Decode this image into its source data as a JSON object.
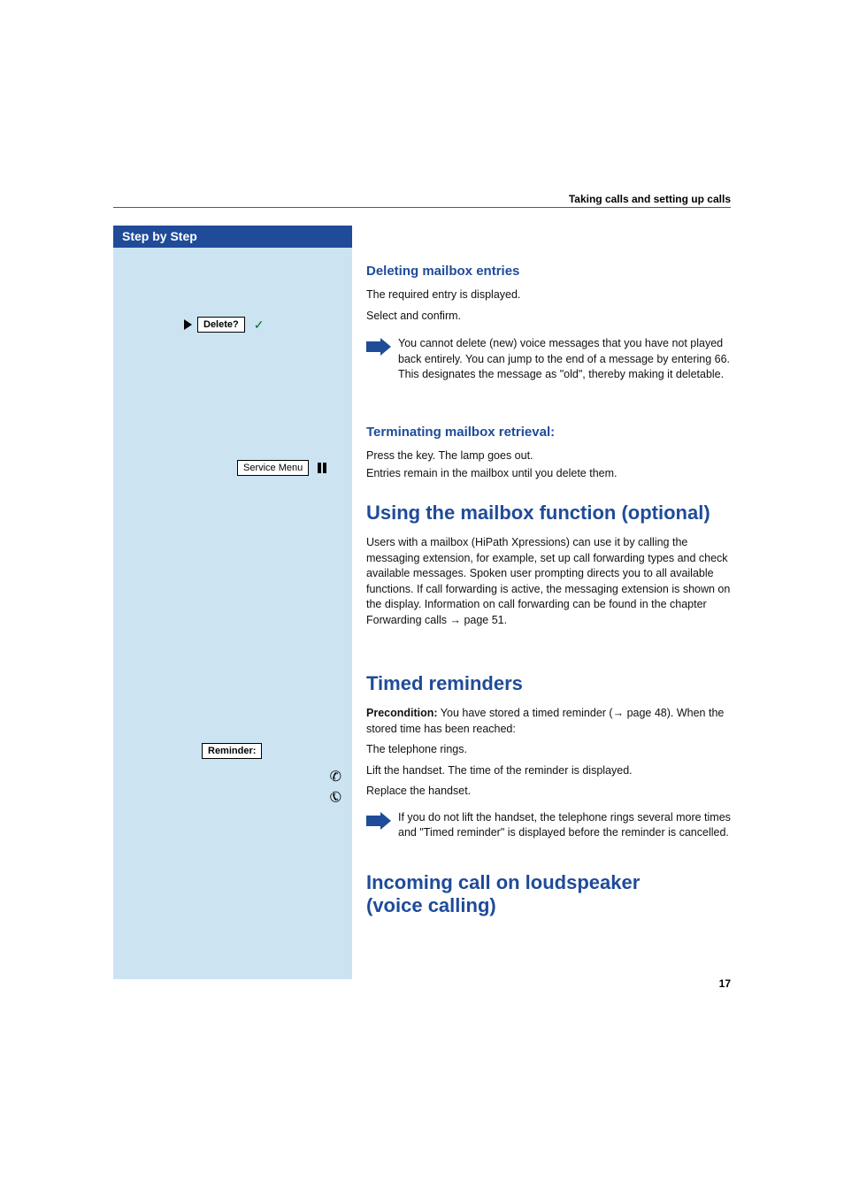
{
  "header": {
    "running_title": "Taking calls and setting up calls"
  },
  "sidebar": {
    "title": "Step by Step",
    "steps": {
      "delete": {
        "label": "Delete?"
      },
      "service_menu": {
        "label": "Service Menu"
      },
      "reminder": {
        "label": "Reminder:"
      }
    }
  },
  "content": {
    "s1": {
      "heading": "Deleting mailbox entries",
      "line1": "The required entry is displayed.",
      "line2": "Select and confirm.",
      "note": "You cannot delete (new) voice messages that you have not played back entirely. You can jump to the end of a message by entering 66. This designates the message as \"old\", thereby making it deletable."
    },
    "s2": {
      "heading": "Terminating mailbox retrieval:",
      "line1": "Press the key. The lamp goes out.",
      "line2": "Entries remain in the mailbox until you delete them."
    },
    "s3": {
      "heading": "Using the mailbox function (optional)",
      "body": "Users with a mailbox (HiPath Xpressions) can use it by calling the messaging extension, for example, set up call forwarding types and check available messages. Spoken user prompting directs you to all available functions. If call forwarding is active, the messaging extension is shown on the display. Information on call forwarding can be found in the chapter Forwarding calls → page 51."
    },
    "s4": {
      "heading": "Timed reminders",
      "pre_label": "Precondition:",
      "pre_body": " You have stored a timed reminder (→ page 48). When the stored time has been reached:",
      "line1": "The telephone rings.",
      "line2": "Lift the handset. The time of the reminder is displayed.",
      "line3": "Replace the handset.",
      "note": "If you do not lift the handset, the telephone rings several more times and \"Timed reminder\" is displayed before the reminder is cancelled."
    },
    "s5": {
      "heading_line1": "Incoming call on loudspeaker",
      "heading_line2": "(voice calling)"
    }
  },
  "page_number": "17"
}
